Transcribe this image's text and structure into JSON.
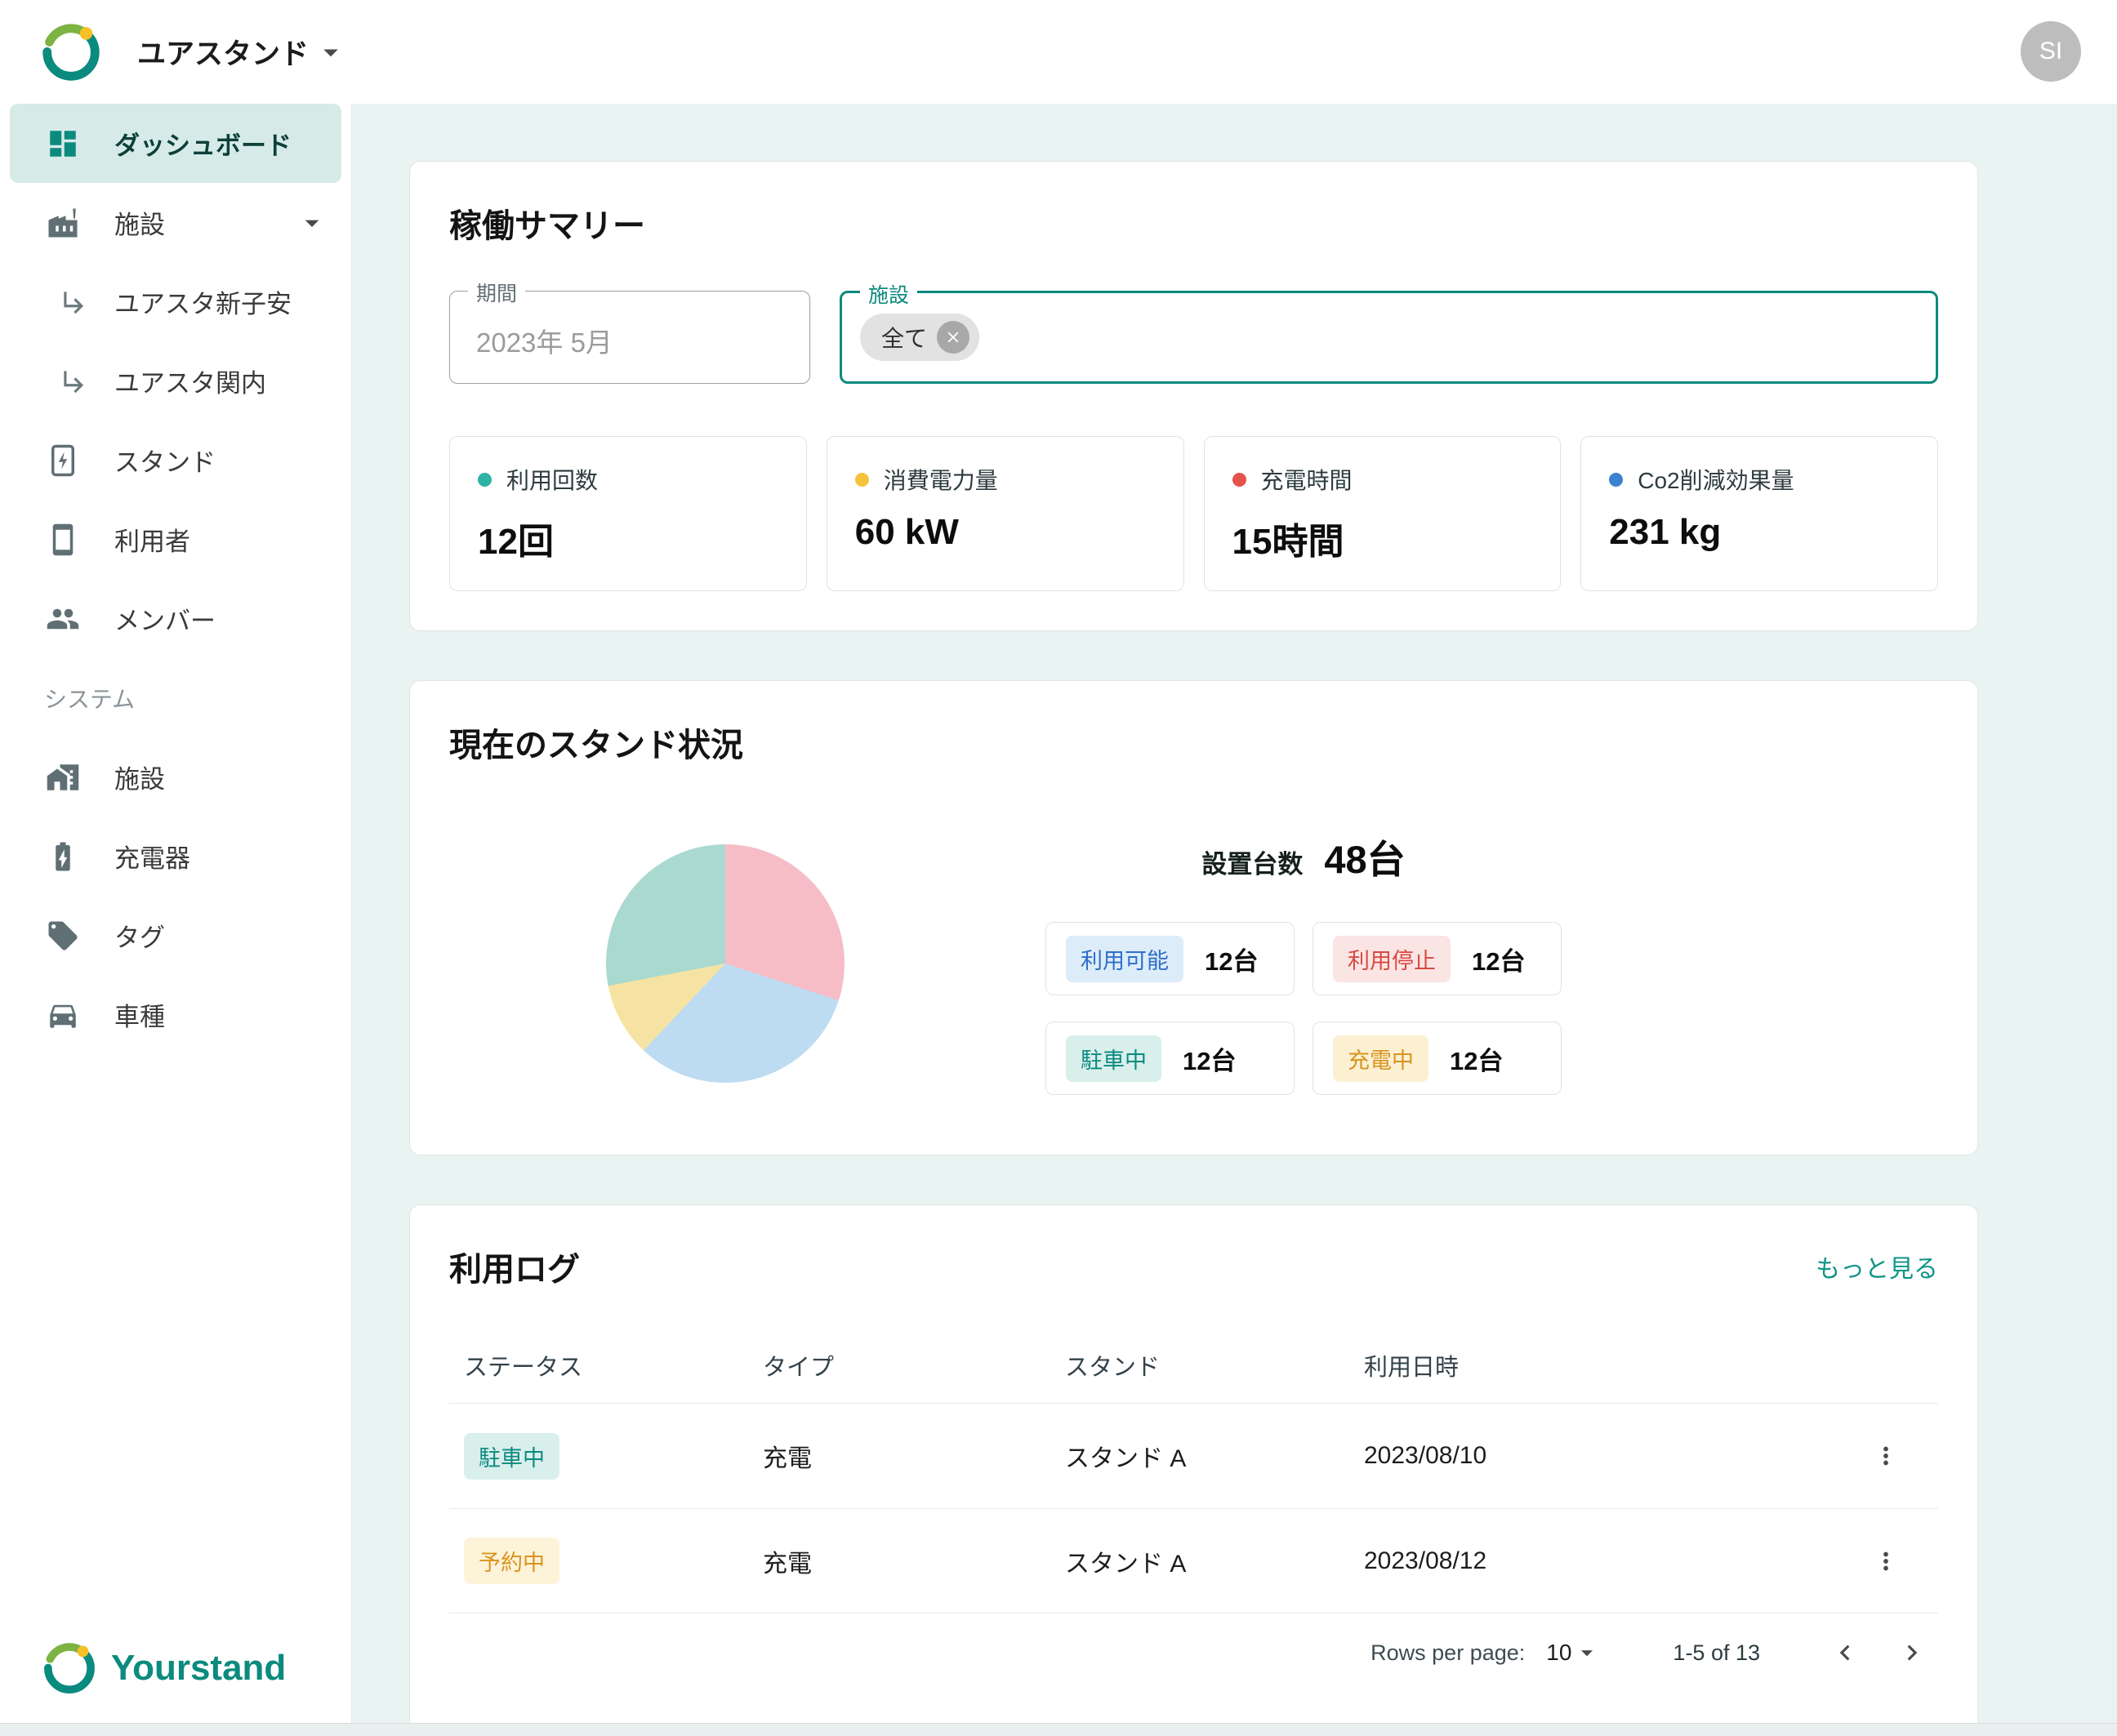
{
  "colors": {
    "primary": "#0c8a7e",
    "active_item_bg": "#d6ebe8",
    "page_bg": "#e9f4f2"
  },
  "header": {
    "app_title": "ユアスタンド",
    "avatar": "SI"
  },
  "sidebar": {
    "items": [
      {
        "label": "ダッシュボード"
      },
      {
        "label": "施設"
      },
      {
        "label": "ユアスタ新子安"
      },
      {
        "label": "ユアスタ関内"
      },
      {
        "label": "スタンド"
      },
      {
        "label": "利用者"
      },
      {
        "label": "メンバー"
      }
    ],
    "section_label": "システム",
    "system_items": [
      {
        "label": "施設"
      },
      {
        "label": "充電器"
      },
      {
        "label": "タグ"
      },
      {
        "label": "車種"
      }
    ],
    "brand": "Yourstand"
  },
  "summary": {
    "title": "稼働サマリー",
    "period": {
      "label": "期間",
      "value": "2023年 5月"
    },
    "facility": {
      "label": "施設",
      "chip": "全て"
    },
    "stats": [
      {
        "label": "利用回数",
        "value": "12回",
        "dot_color": "#2bb3a3"
      },
      {
        "label": "消費電力量",
        "value": "60 kW",
        "dot_color": "#f5c33b"
      },
      {
        "label": "充電時間",
        "value": "15時間",
        "dot_color": "#e5534b"
      },
      {
        "label": "Co2削減効果量",
        "value": "231 kg",
        "dot_color": "#3b82d1"
      }
    ]
  },
  "stand_status": {
    "title": "現在のスタンド状況",
    "total_label": "設置台数",
    "total_value": "48台",
    "chart_data": {
      "type": "pie",
      "title": "現在のスタンド状況",
      "total_units": 48,
      "counts": {
        "利用可能": 12,
        "利用停止": 12,
        "駐車中": 12,
        "充電中": 12
      },
      "segments": [
        {
          "label": "利用停止",
          "color": "#f6bdc6",
          "fraction": 0.3
        },
        {
          "label": "利用可能",
          "color": "#bddcf2",
          "fraction": 0.32
        },
        {
          "label": "充電中",
          "color": "#f6e3a3",
          "fraction": 0.1
        },
        {
          "label": "駐車中",
          "color": "#aad9d0",
          "fraction": 0.28
        }
      ]
    },
    "boxes": [
      {
        "label": "利用可能",
        "count": "12台",
        "fg": "#2f6fca",
        "bg": "#ddecf9"
      },
      {
        "label": "利用停止",
        "count": "12台",
        "fg": "#d84a42",
        "bg": "#fbe4e4"
      },
      {
        "label": "駐車中",
        "count": "12台",
        "fg": "#0b8a7f",
        "bg": "#d9efec"
      },
      {
        "label": "充電中",
        "count": "12台",
        "fg": "#d9941f",
        "bg": "#fbf0d2"
      }
    ]
  },
  "usage_log": {
    "title": "利用ログ",
    "more_link": "もっと見る",
    "columns": [
      "ステータス",
      "タイプ",
      "スタンド",
      "利用日時"
    ],
    "rows": [
      {
        "status": "駐車中",
        "status_fg": "#0b8a7f",
        "status_bg": "#d9efec",
        "type": "充電",
        "stand": "スタンド A",
        "used_at": "2023/08/10"
      },
      {
        "status": "予約中",
        "status_fg": "#d9941f",
        "status_bg": "#fdf3d8",
        "type": "充電",
        "stand": "スタンド A",
        "used_at": "2023/08/12"
      }
    ],
    "pagination": {
      "rows_per_page_label": "Rows per page:",
      "rows_per_page": "10",
      "range": "1-5 of 13"
    }
  }
}
